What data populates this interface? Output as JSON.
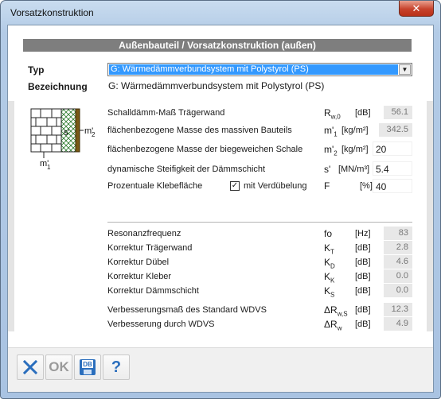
{
  "window": {
    "title": "Vorsatzkonstruktion",
    "close_glyph": "✕"
  },
  "header": {
    "title": "Außenbauteil / Vorsatzkonstruktion (außen)"
  },
  "type": {
    "label": "Typ",
    "selected": "G: Wärmedämmverbundsystem mit Polystyrol (PS)"
  },
  "designation": {
    "label": "Bezeichnung",
    "value": "G: Wärmedämmverbundsystem mit Polystyrol (PS)"
  },
  "diagram": {
    "s_label": "s'",
    "m2_label": "m'",
    "m2_sub": "2",
    "m1_label": "m'",
    "m1_sub": "1"
  },
  "inputs": [
    {
      "label": "Schalldämm-Maß Trägerwand",
      "symbol": "R",
      "sub": "w,0",
      "unit": "[dB]",
      "value": "56.1",
      "editable": false
    },
    {
      "label": "flächenbezogene Masse des massiven Bauteils",
      "symbol": "m'",
      "sub": "1",
      "unit": "[kg/m²]",
      "value": "342.5",
      "editable": false
    },
    {
      "label": "flächenbezogene Masse der biegeweichen Schale",
      "symbol": "m'",
      "sub": "2",
      "unit": "[kg/m²]",
      "value": "20",
      "editable": true
    },
    {
      "label": "dynamische Steifigkeit der Dämmschicht",
      "symbol": "s'",
      "sub": "",
      "unit": "[MN/m³]",
      "value": "5.4",
      "editable": true
    },
    {
      "label": "Prozentuale Klebefläche",
      "symbol": "F",
      "sub": "",
      "unit": "[%]",
      "value": "40",
      "editable": true
    }
  ],
  "dowel_checkbox": {
    "label": "mit Verdübelung",
    "checked": true,
    "check_glyph": "✓"
  },
  "results": [
    {
      "label": "Resonanzfrequenz",
      "symbol": "fo",
      "sub": "",
      "unit": "[Hz]",
      "value": "83"
    },
    {
      "label": "Korrektur Trägerwand",
      "symbol": "K",
      "sub": "T",
      "unit": "[dB]",
      "value": "2.8"
    },
    {
      "label": "Korrektur Dübel",
      "symbol": "K",
      "sub": "D",
      "unit": "[dB]",
      "value": "4.6"
    },
    {
      "label": "Korrektur Kleber",
      "symbol": "K",
      "sub": "K",
      "unit": "[dB]",
      "value": "0.0"
    },
    {
      "label": "Korrektur Dämmschicht",
      "symbol": "K",
      "sub": "S",
      "unit": "[dB]",
      "value": "0.0"
    },
    {
      "label": "Verbesserungsmaß des Standard WDVS",
      "symbol": "ΔR",
      "sub": "w,S",
      "unit": "[dB]",
      "value": "12.3"
    },
    {
      "label": "Verbesserung durch WDVS",
      "symbol": "ΔR",
      "sub": "w",
      "unit": "[dB]",
      "value": "4.9"
    }
  ],
  "toolbar": {
    "ok_label": "OK",
    "help_label": "?",
    "db_label": "DB"
  },
  "colors": {
    "accent": "#2a6ebd",
    "header_bg": "#7e7e7e",
    "selection": "#3399ff"
  }
}
